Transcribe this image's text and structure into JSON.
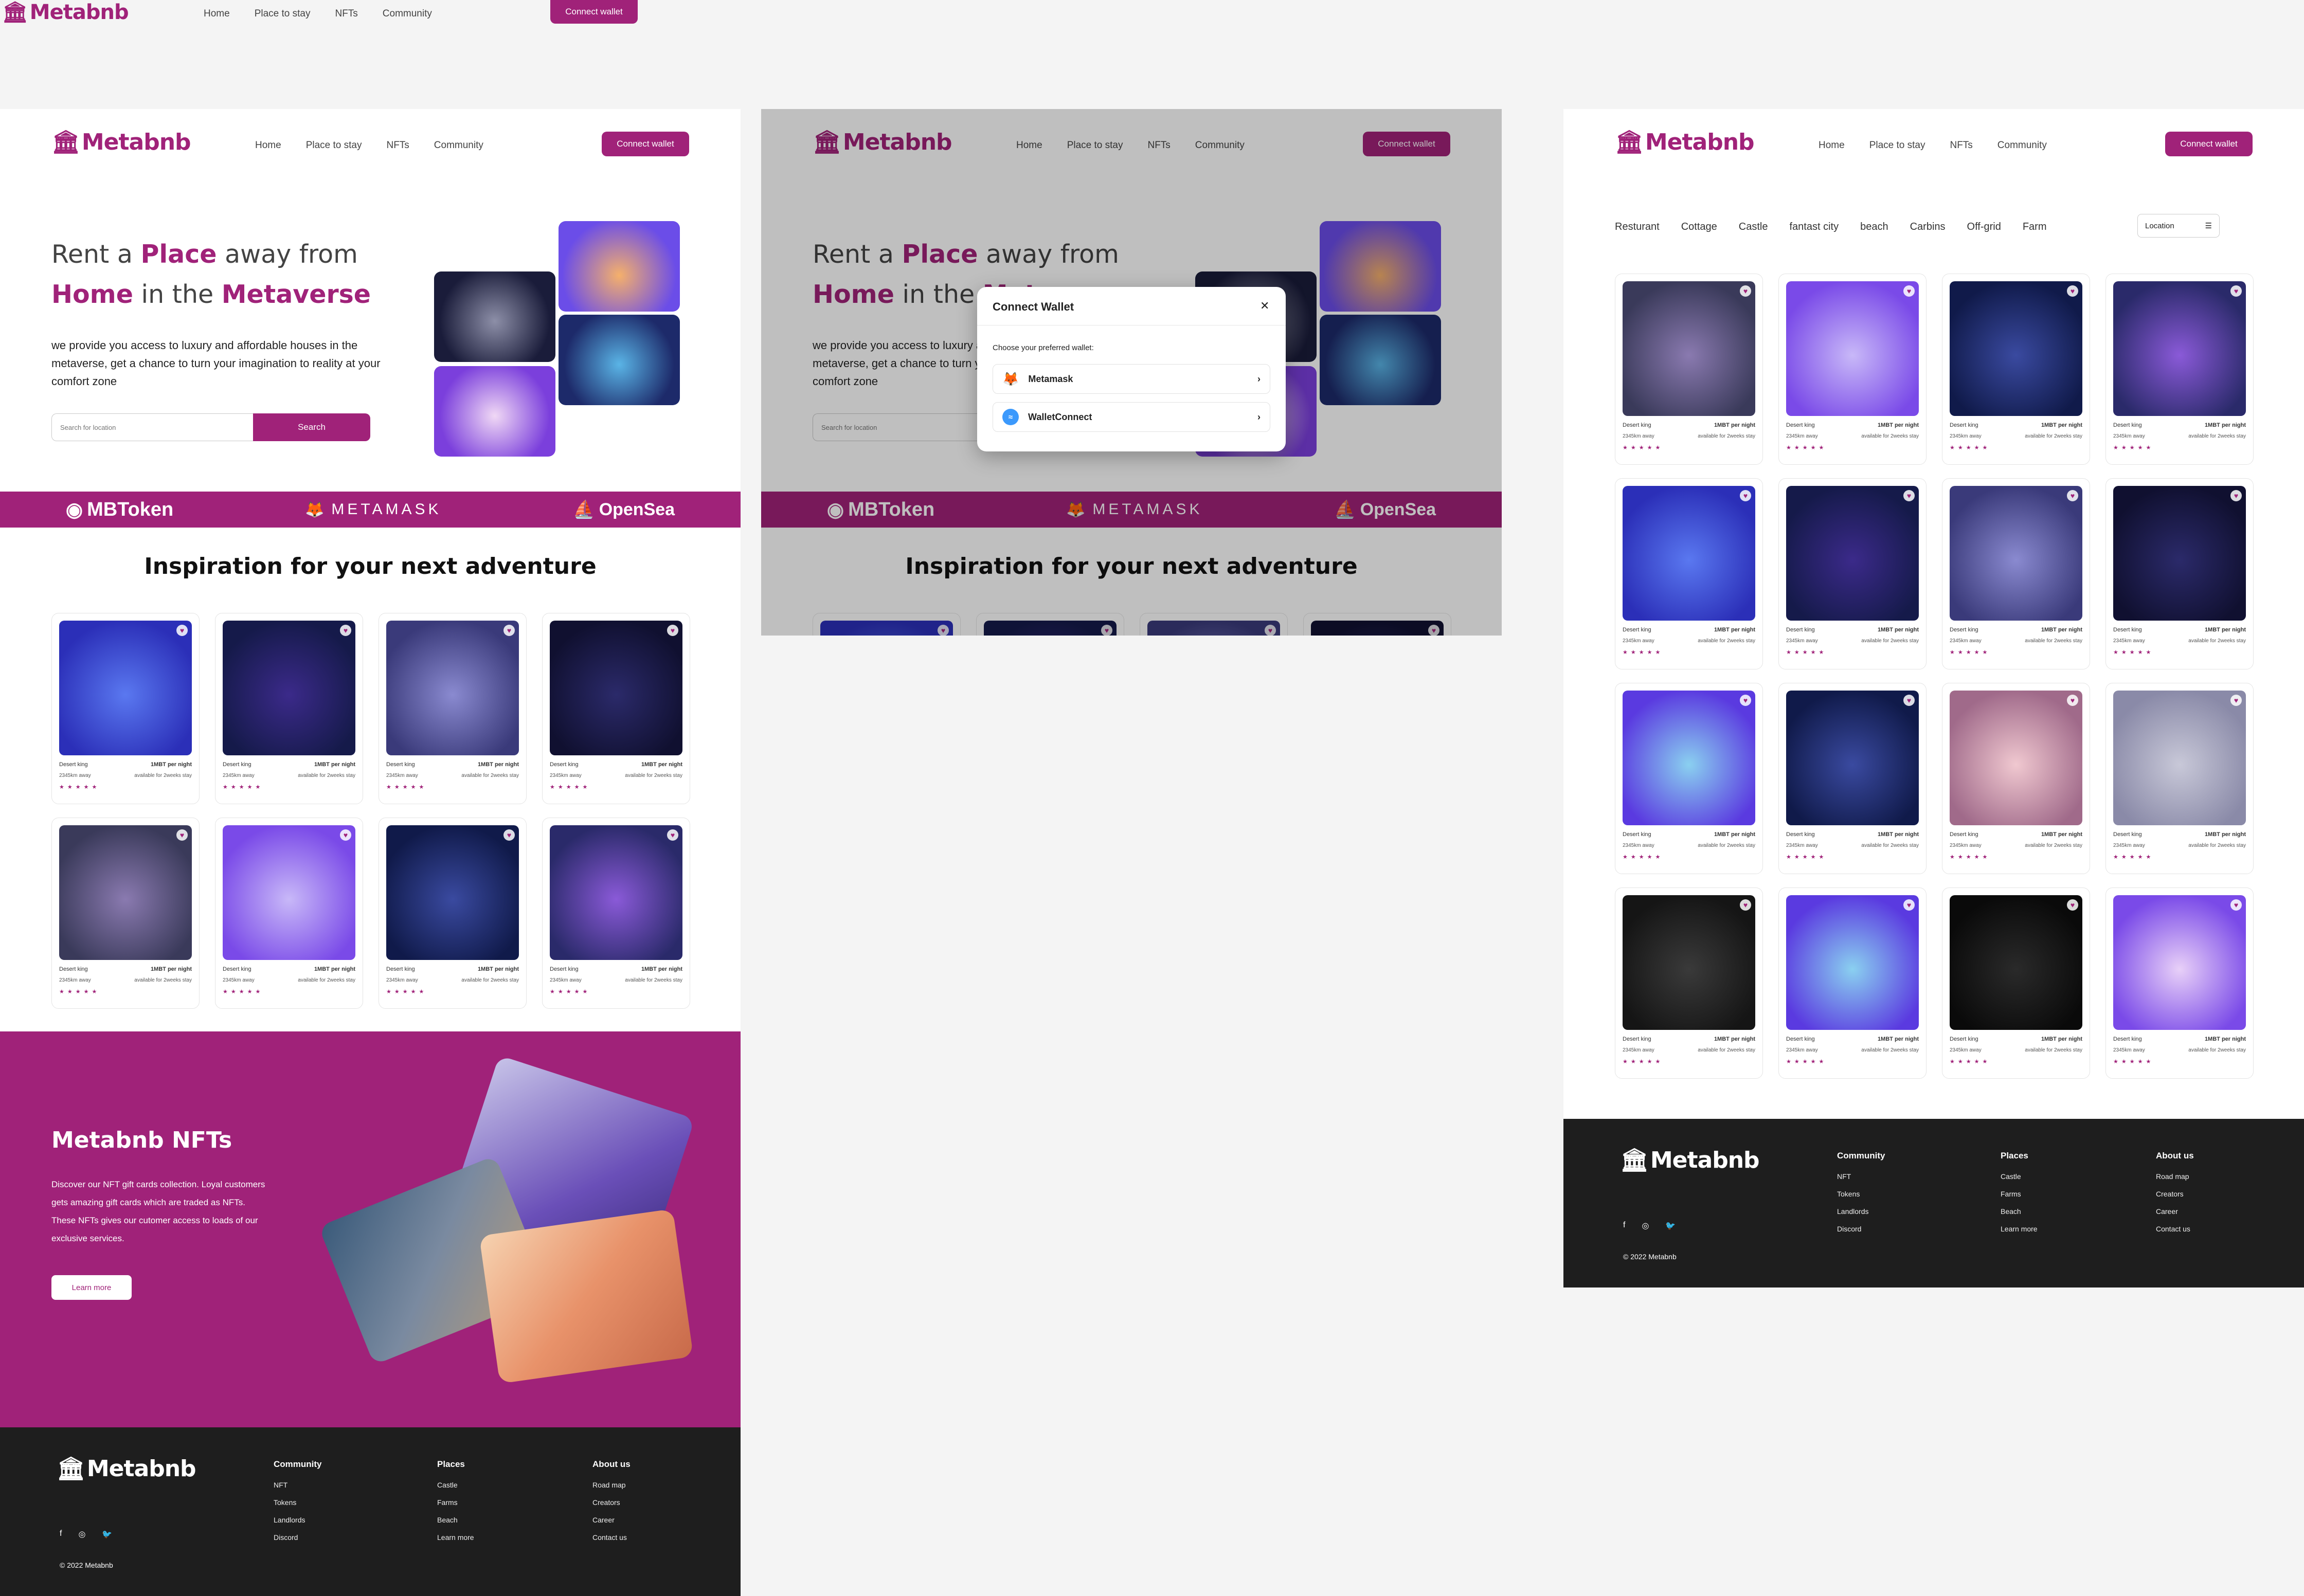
{
  "brand": {
    "name": "Metabnb",
    "accent": "#a02279",
    "dark": "#1e1e1e"
  },
  "nav": {
    "items": [
      "Home",
      "Place to stay",
      "NFTs",
      "Community"
    ],
    "connect": "Connect wallet"
  },
  "hero": {
    "title_a": "Rent a",
    "title_b": "Place",
    "title_c": "away from",
    "title_d": "Home",
    "title_e": "in the",
    "title_f": "Metaverse",
    "desc": "we provide you access to luxury and affordable houses in the metaverse, get a chance to turn your imagination to reality at your comfort zone",
    "search_placeholder": "Search for location",
    "search_btn": "Search"
  },
  "partners": [
    "MBToken",
    "METAMASK",
    "OpenSea"
  ],
  "inspiration": {
    "title": "Inspiration for your next adventure"
  },
  "card": {
    "name": "Desert king",
    "price": "1MBT per night",
    "distance": "2345km away",
    "availability": "available for 2weeks stay",
    "stars": "★★★★★"
  },
  "nfts": {
    "title": "Metabnb NFTs",
    "desc": "Discover our NFT gift cards collection. Loyal customers gets amazing gift cards which are traded as NFTs. These NFTs gives our cutomer access to loads of our exclusive services.",
    "btn": "Learn more"
  },
  "footer": {
    "cols": [
      {
        "title": "Community",
        "items": [
          "NFT",
          "Tokens",
          "Landlords",
          "Discord"
        ]
      },
      {
        "title": "Places",
        "items": [
          "Castle",
          "Farms",
          "Beach",
          "Learn more"
        ]
      },
      {
        "title": "About us",
        "items": [
          "Road map",
          "Creators",
          "Career",
          "Contact us"
        ]
      }
    ],
    "copyright": "2022 Metabnb"
  },
  "modal": {
    "title": "Connect Wallet",
    "subtitle": "Choose your preferred wallet:",
    "options": [
      "Metamask",
      "WalletConnect"
    ]
  },
  "filters": {
    "items": [
      "Resturant",
      "Cottage",
      "Castle",
      "fantast city",
      "beach",
      "Carbins",
      "Off-grid",
      "Farm"
    ],
    "location": "Location"
  }
}
